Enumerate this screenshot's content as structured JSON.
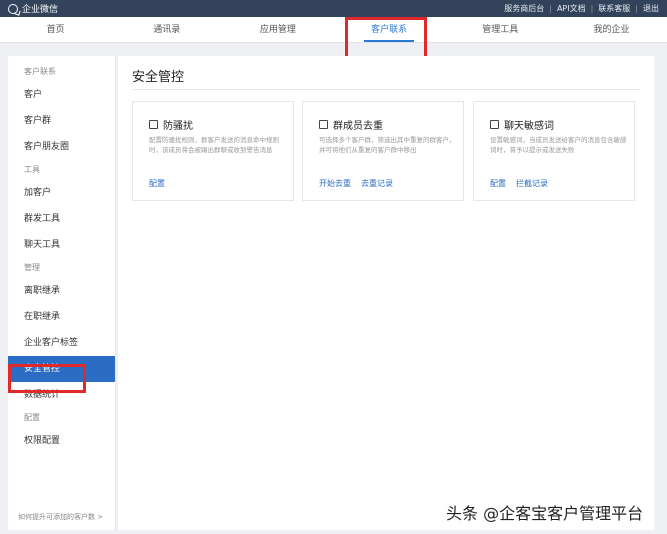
{
  "topbar": {
    "brand": "企业微信",
    "links": [
      "服务商后台",
      "API文档",
      "联系客服",
      "退出"
    ]
  },
  "nav": {
    "tabs": [
      {
        "label": "首页",
        "active": false
      },
      {
        "label": "通讯录",
        "active": false
      },
      {
        "label": "应用管理",
        "active": false
      },
      {
        "label": "客户联系",
        "active": true
      },
      {
        "label": "管理工具",
        "active": false
      },
      {
        "label": "我的企业",
        "active": false
      }
    ]
  },
  "sidebar": {
    "groups": [
      {
        "title": "客户联系",
        "items": [
          "客户",
          "客户群",
          "客户朋友圈"
        ]
      },
      {
        "title": "工具",
        "items": [
          "加客户",
          "群发工具",
          "聊天工具"
        ]
      },
      {
        "title": "管理",
        "items": [
          "离职继承",
          "在职继承",
          "企业客户标签",
          "安全管控",
          "数据统计"
        ]
      },
      {
        "title": "配置",
        "items": [
          "权限配置"
        ]
      }
    ],
    "active_item": "安全管控",
    "footer": "如何提升可添加的客户数 >"
  },
  "main": {
    "title": "安全管控",
    "cards": [
      {
        "icon": "anti-harassment-icon",
        "title": "防骚扰",
        "desc": "配置防骚扰规则，群客户发送的消息命中规则时，该成员将会被踢出群聊或收到警告消息",
        "links": [
          "配置"
        ]
      },
      {
        "icon": "dedupe-icon",
        "title": "群成员去重",
        "desc": "可选择多个客户群，筛选出其中重复的群客户，并可将他们从重复的客户群中移出",
        "links": [
          "开始去重",
          "去重记录"
        ]
      },
      {
        "icon": "sensitive-words-icon",
        "title": "聊天敏感词",
        "desc": "设置敏感词，当成员发送给客户的消息包含敏感词时，将予以提示或发送失败",
        "links": [
          "配置",
          "拦截记录"
        ]
      }
    ]
  },
  "watermark": "头条 @企客宝客户管理平台"
}
